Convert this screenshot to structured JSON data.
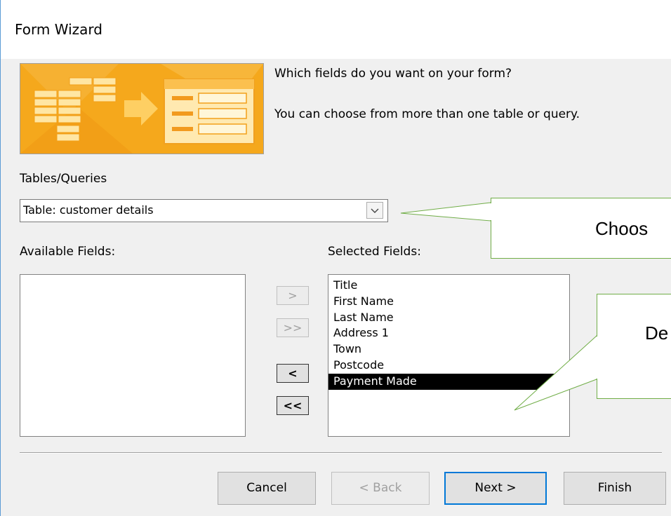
{
  "window": {
    "title": "Form Wizard"
  },
  "intro": {
    "question": "Which fields do you want on your form?",
    "hint": "You can choose from more than one table or query."
  },
  "tables": {
    "label": "Tables/Queries",
    "selected": "Table: customer details"
  },
  "available": {
    "label": "Available Fields:",
    "items": []
  },
  "selected": {
    "label": "Selected Fields:",
    "items": [
      "Title",
      "First Name",
      "Last Name",
      "Address 1",
      "Town",
      "Postcode",
      "Payment Made"
    ],
    "highlighted_item": "Payment Made"
  },
  "move_buttons": {
    "add_one": ">",
    "add_all": ">>",
    "remove_one": "<",
    "remove_all": "<<"
  },
  "footer": {
    "cancel": "Cancel",
    "back": "< Back",
    "next": "Next >",
    "finish": "Finish"
  },
  "annotations": {
    "callout_1": "Choos",
    "callout_2": "De"
  },
  "colors": {
    "accent": "#0078d7",
    "hero": "#f6a91e",
    "callout_border": "#70ad47"
  }
}
